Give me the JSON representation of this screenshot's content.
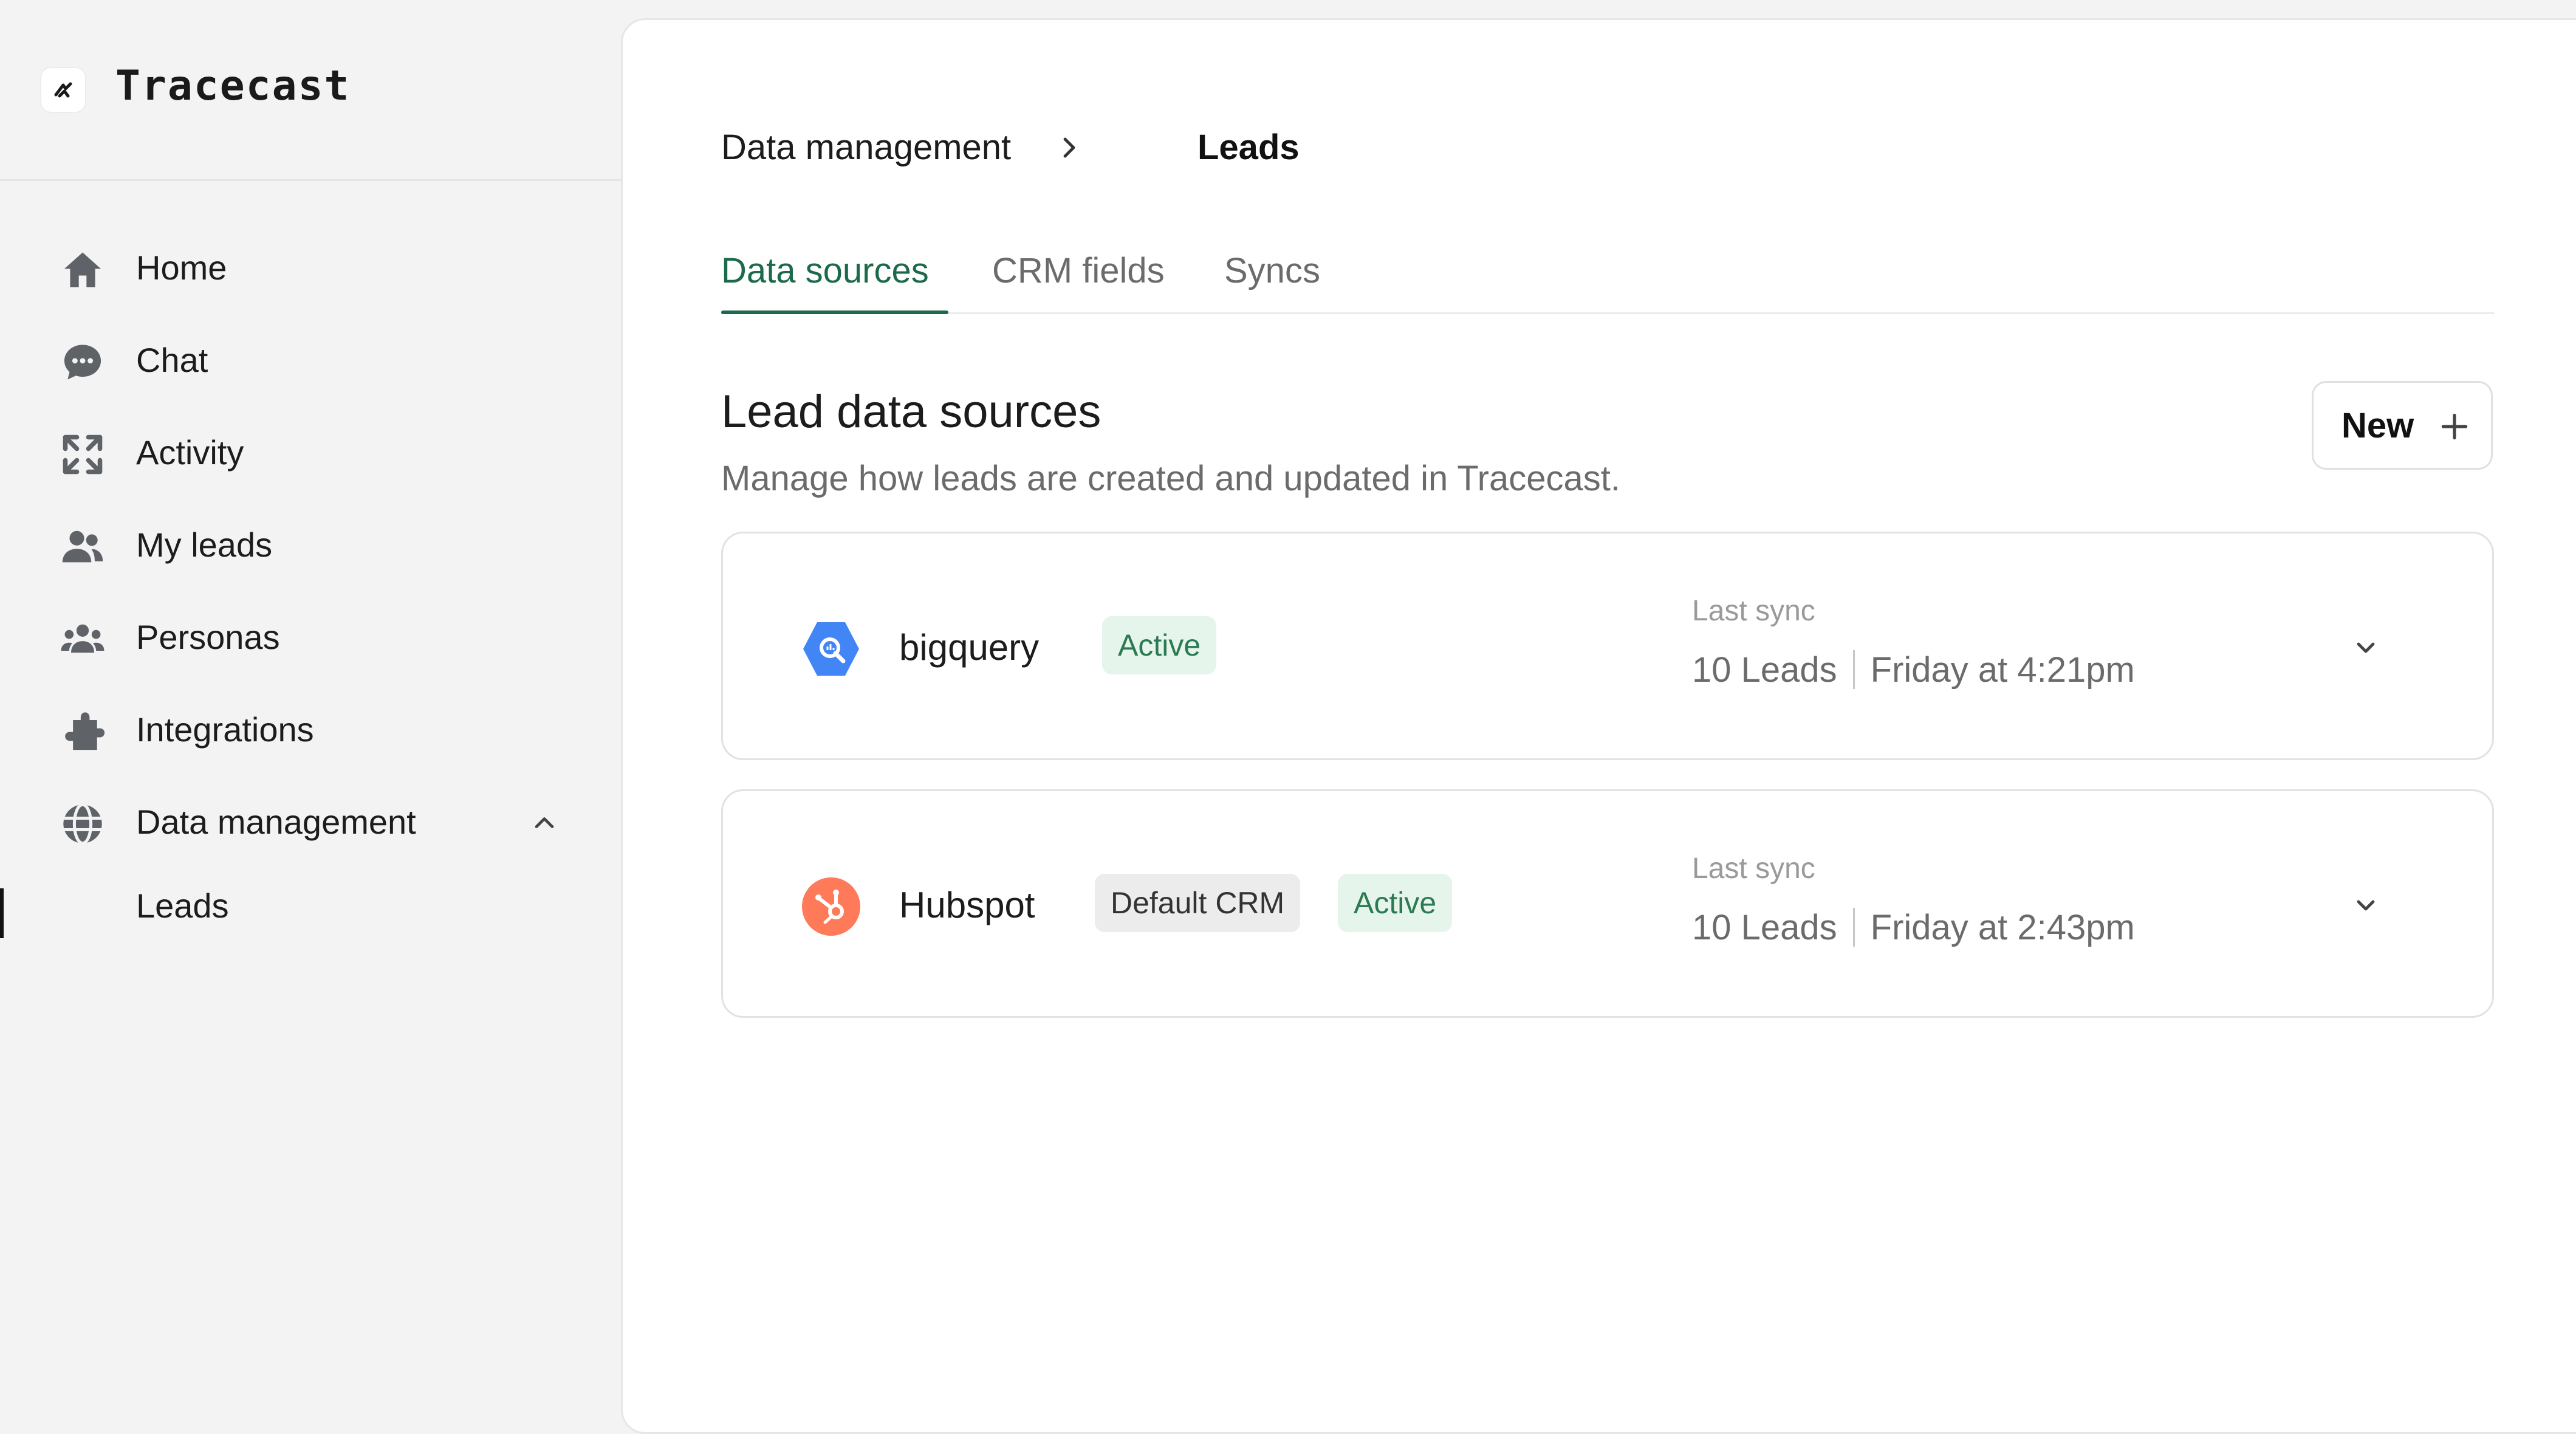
{
  "app": {
    "name": "Tracecast"
  },
  "sidebar": {
    "items": [
      {
        "label": "Home",
        "icon": "home-icon"
      },
      {
        "label": "Chat",
        "icon": "chat-icon"
      },
      {
        "label": "Activity",
        "icon": "activity-icon"
      },
      {
        "label": "My leads",
        "icon": "users-icon"
      },
      {
        "label": "Personas",
        "icon": "personas-icon"
      },
      {
        "label": "Integrations",
        "icon": "puzzle-icon"
      },
      {
        "label": "Data management",
        "icon": "globe-icon",
        "expanded": true
      },
      {
        "label": "Leads",
        "selected": true
      }
    ]
  },
  "breadcrumb": {
    "parent": "Data management",
    "current": "Leads"
  },
  "tabs": [
    {
      "label": "Data sources",
      "active": true
    },
    {
      "label": "CRM fields",
      "active": false
    },
    {
      "label": "Syncs",
      "active": false
    }
  ],
  "section": {
    "title": "Lead data sources",
    "subtitle": "Manage how leads are created and updated in Tracecast."
  },
  "new_button": {
    "label": "New"
  },
  "sources": [
    {
      "name": "bigquery",
      "icon": "bigquery-icon",
      "badges": [
        "Active"
      ],
      "last_sync_label": "Last sync",
      "last_sync_count": "10 Leads",
      "last_sync_time": "Friday at 4:21pm"
    },
    {
      "name": "Hubspot",
      "icon": "hubspot-icon",
      "badges": [
        "Default CRM",
        "Active"
      ],
      "last_sync_label": "Last sync",
      "last_sync_count": "10 Leads",
      "last_sync_time": "Friday at 2:43pm"
    }
  ],
  "colors": {
    "accent": "#1c6a4a",
    "badge_active_bg": "#e6f5ec",
    "badge_active_text": "#2c7a52",
    "bigquery": "#4285f4",
    "hubspot": "#ff7a59"
  }
}
